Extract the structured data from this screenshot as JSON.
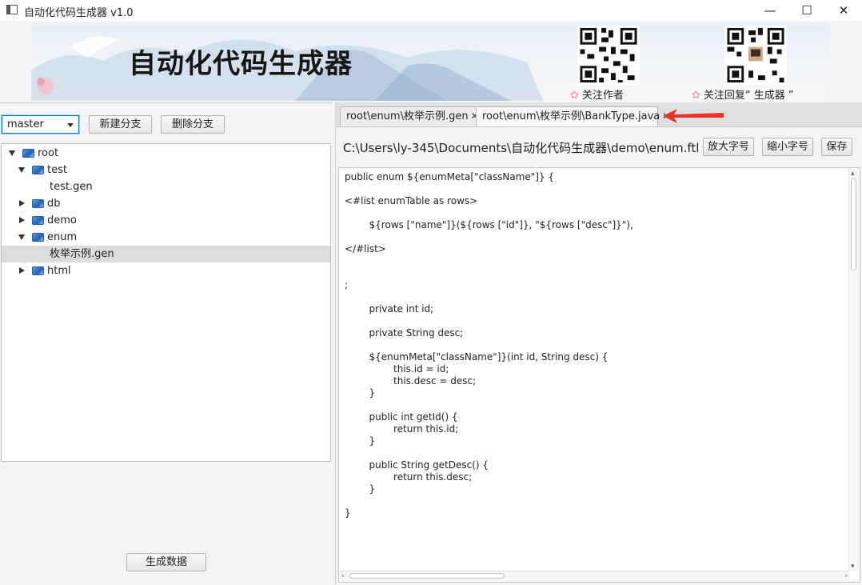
{
  "window": {
    "title": "自动化代码生成器 v1.0",
    "controls": {
      "minimize": "—",
      "maximize": "☐",
      "close": "✕"
    }
  },
  "banner": {
    "title": "自动化代码生成器",
    "qr_left_caption": "关注作者",
    "qr_right_caption": "关注回复“ 生成器 ”"
  },
  "left_panel": {
    "branch_value": "master",
    "new_branch_label": "新建分支",
    "delete_branch_label": "删除分支",
    "generate_label": "生成数据",
    "tree": [
      {
        "label": "root",
        "type": "folder",
        "state": "open",
        "level": 0
      },
      {
        "label": "test",
        "type": "folder",
        "state": "open",
        "level": 1
      },
      {
        "label": "test.gen",
        "type": "file",
        "level": 2
      },
      {
        "label": "db",
        "type": "folder",
        "state": "closed",
        "level": 1
      },
      {
        "label": "demo",
        "type": "folder",
        "state": "closed",
        "level": 1
      },
      {
        "label": "enum",
        "type": "folder",
        "state": "open",
        "level": 1
      },
      {
        "label": "枚举示例.gen",
        "type": "file",
        "level": 2,
        "selected": true
      },
      {
        "label": "html",
        "type": "folder",
        "state": "closed",
        "level": 1
      }
    ]
  },
  "editor": {
    "tabs": [
      {
        "label": "root\\enum\\枚举示例.gen",
        "close": "✕"
      },
      {
        "label": "root\\enum\\枚举示例\\BankType.java",
        "close": "✕"
      }
    ],
    "active_tab": 1,
    "file_path": "C:\\Users\\ly-345\\Documents\\自动化代码生成器\\demo\\enum.ftl",
    "zoom_in_label": "放大字号",
    "zoom_out_label": "缩小字号",
    "save_label": "保存",
    "code_lines": [
      "public enum ${enumMeta[\"className\"]} {",
      "",
      "<#list enumTable as rows>",
      "",
      "        ${rows [\"name\"]}(${rows [\"id\"]}, \"${rows [\"desc\"]}\"),",
      "",
      "</#list>",
      "",
      "",
      ";",
      "",
      "        private int id;",
      "",
      "        private String desc;",
      "",
      "        ${enumMeta[\"className\"]}(int id, String desc) {",
      "                this.id = id;",
      "                this.desc = desc;",
      "        }",
      "",
      "        public int getId() {",
      "                return this.id;",
      "        }",
      "",
      "        public String getDesc() {",
      "                return this.desc;",
      "        }",
      "",
      "}"
    ]
  },
  "colors": {
    "accent": "#0078d7",
    "annotation_arrow": "#e8332c",
    "selection": "#dcdcdc"
  }
}
